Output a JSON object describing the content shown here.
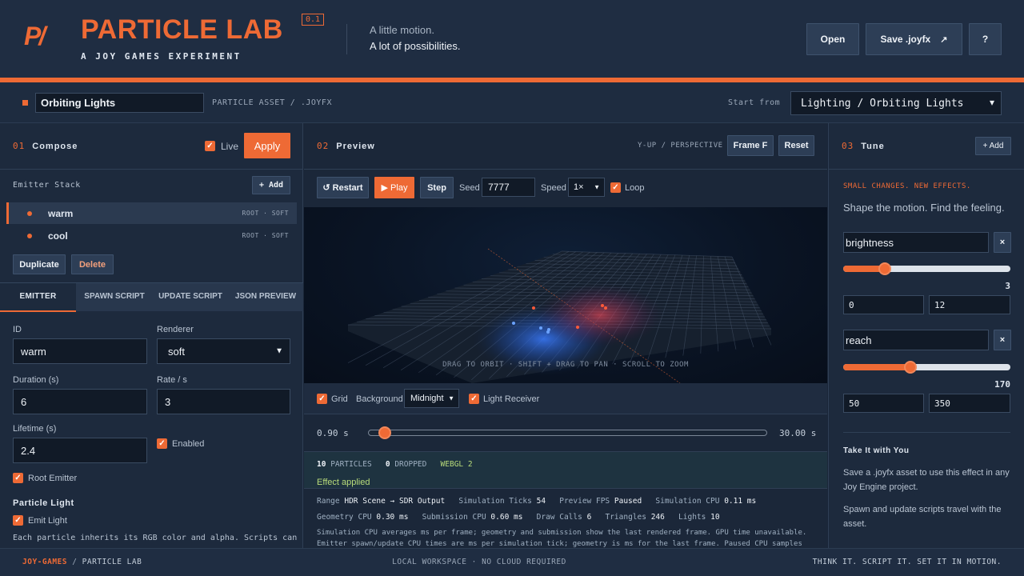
{
  "header": {
    "logo_mark": "P/",
    "title": "PARTICLE LAB",
    "version": "0.1",
    "subtitle": "A JOY GAMES EXPERIMENT",
    "tagline1": "A little motion.",
    "tagline2": "A lot of possibilities.",
    "open_label": "Open",
    "save_label": "Save .joyfx",
    "save_icon": "↗",
    "help_label": "?"
  },
  "asset": {
    "name": "Orbiting Lights",
    "type_label": "PARTICLE ASSET / .JOYFX",
    "start_from_label": "Start from",
    "start_from_value": "Lighting / Orbiting Lights"
  },
  "compose": {
    "num": "01",
    "title": "Compose",
    "live_label": "Live",
    "apply_label": "Apply",
    "emitter_stack_label": "Emitter Stack",
    "add_label": "+ Add",
    "emitters": [
      {
        "name": "warm",
        "tag": "ROOT · SOFT"
      },
      {
        "name": "cool",
        "tag": "ROOT · SOFT"
      }
    ],
    "duplicate_label": "Duplicate",
    "delete_label": "Delete",
    "tabs": [
      "EMITTER",
      "SPAWN SCRIPT",
      "UPDATE SCRIPT",
      "JSON PREVIEW"
    ],
    "id_label": "ID",
    "id_value": "warm",
    "renderer_label": "Renderer",
    "renderer_value": "soft",
    "duration_label": "Duration (s)",
    "duration_value": "6",
    "rate_label": "Rate / s",
    "rate_value": "3",
    "lifetime_label": "Lifetime (s)",
    "lifetime_value": "2.4",
    "enabled_label": "Enabled",
    "root_emitter_label": "Root Emitter",
    "particle_light_title": "Particle Light",
    "emit_light_label": "Emit Light",
    "note": "Each particle inherits its RGB color and alpha. Scripts can"
  },
  "preview": {
    "num": "02",
    "title": "Preview",
    "orientation_label": "Y-UP / PERSPECTIVE",
    "frame_label": "Frame F",
    "reset_label": "Reset",
    "restart_label": "↺ Restart",
    "play_label": "▶ Play",
    "step_label": "Step",
    "seed_label": "Seed",
    "seed_value": "7777",
    "speed_label": "Speed",
    "speed_value": "1×",
    "loop_label": "Loop",
    "viewport_hint": "DRAG TO ORBIT · SHIFT + DRAG TO PAN · SCROLL TO ZOOM",
    "grid_label": "Grid",
    "background_label": "Background",
    "background_value": "Midnight",
    "light_receiver_label": "Light Receiver",
    "time_current": "0.90 s",
    "time_total": "30.00 s",
    "timeline_progress": 0.03,
    "particles_count": "10",
    "particles_label": "PARTICLES",
    "dropped_count": "0",
    "dropped_label": "DROPPED",
    "renderer_api": "WEBGL 2",
    "status_msg": "Effect applied",
    "stats": {
      "range_label": "Range",
      "range_value": "HDR Scene → SDR Output",
      "sim_ticks_label": "Simulation Ticks",
      "sim_ticks_value": "54",
      "fps_label": "Preview FPS",
      "fps_value": "Paused",
      "sim_cpu_label": "Simulation CPU",
      "sim_cpu_value": "0.11 ms",
      "geo_cpu_label": "Geometry CPU",
      "geo_cpu_value": "0.30 ms",
      "sub_cpu_label": "Submission CPU",
      "sub_cpu_value": "0.60 ms",
      "draw_calls_label": "Draw Calls",
      "draw_calls_value": "6",
      "triangles_label": "Triangles",
      "triangles_value": "246",
      "lights_label": "Lights",
      "lights_value": "10",
      "note1": "Simulation CPU averages ms per frame; geometry and submission show the last rendered frame. GPU time unavailable.",
      "note2": "Emitter spawn/update CPU times are ms per simulation tick; geometry is ms for the last frame. Paused CPU samples"
    }
  },
  "tune": {
    "num": "03",
    "title": "Tune",
    "add_label": "+ Add",
    "kicker": "SMALL CHANGES. NEW EFFECTS.",
    "lead": "Shape the motion. Find the feeling.",
    "params": [
      {
        "name": "brightness",
        "value": "3",
        "min": "0",
        "max": "12",
        "fraction": 0.25
      },
      {
        "name": "reach",
        "value": "170",
        "min": "50",
        "max": "350",
        "fraction": 0.4
      }
    ],
    "remove_label": "×",
    "take_title": "Take It with You",
    "take_p1": "Save a .joyfx asset to use this effect in any Joy Engine project.",
    "take_p2": "Spawn and update scripts travel with the asset."
  },
  "footer": {
    "brand": "JOY-GAMES",
    "sep": " / ",
    "app": "PARTICLE LAB",
    "center": "LOCAL WORKSPACE · NO CLOUD REQUIRED",
    "right": "THINK IT. SCRIPT IT. SET IT IN MOTION."
  },
  "colors": {
    "accent": "#ee6a35",
    "bg": "#1a2638",
    "panel": "#1d2a3d"
  }
}
